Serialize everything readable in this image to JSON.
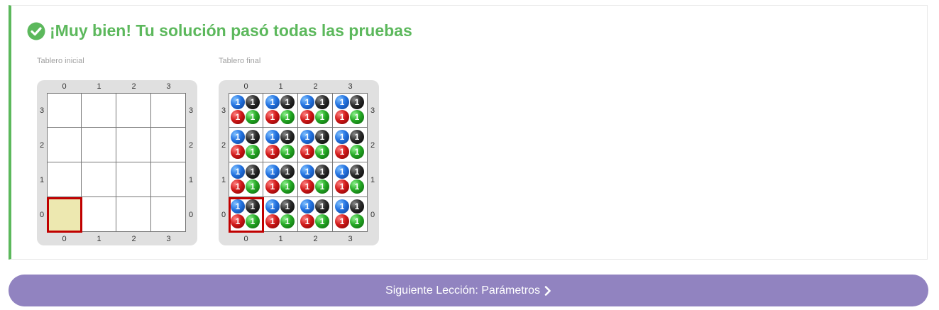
{
  "result": {
    "title": "¡Muy bien! Tu solución pasó todas las pruebas",
    "status_color": "#5cb85c",
    "status_icon": "check-circle-icon"
  },
  "boards": [
    {
      "caption": "Tablero inicial",
      "columns": [
        "0",
        "1",
        "2",
        "3"
      ],
      "rows": [
        "3",
        "2",
        "1",
        "0"
      ],
      "head": {
        "x": 0,
        "y": 0
      },
      "cells": []
    },
    {
      "caption": "Tablero final",
      "columns": [
        "0",
        "1",
        "2",
        "3"
      ],
      "rows": [
        "3",
        "2",
        "1",
        "0"
      ],
      "head": {
        "x": 0,
        "y": 0
      },
      "ball_counts": {
        "blue": "1",
        "black": "1",
        "red": "1",
        "green": "1"
      },
      "ball_colors": {
        "blue": "#2272e0",
        "black": "#222222",
        "red": "#d01818",
        "green": "#23a823"
      }
    }
  ],
  "next_button": {
    "label": "Siguiente Lección: Parámetros",
    "color": "#9183c0",
    "icon": "chevron-right-icon"
  }
}
